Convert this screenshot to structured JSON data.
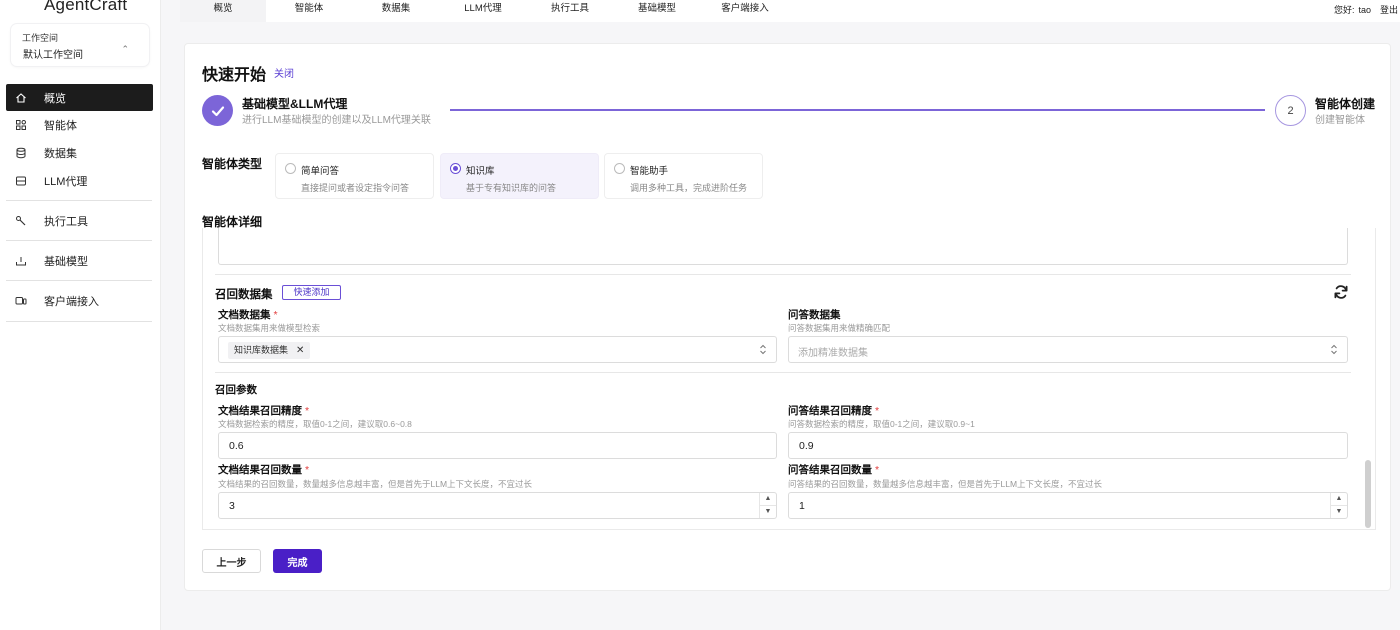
{
  "app": {
    "name": "AgentCraft"
  },
  "workspace": {
    "label": "工作空间",
    "value": "默认工作空间"
  },
  "sidebar": {
    "items": [
      {
        "label": "概览",
        "icon": "home-icon"
      },
      {
        "label": "智能体",
        "icon": "apps-icon"
      },
      {
        "label": "数据集",
        "icon": "database-icon"
      },
      {
        "label": "LLM代理",
        "icon": "server-icon"
      },
      {
        "label": "执行工具",
        "icon": "tool-icon"
      },
      {
        "label": "基础模型",
        "icon": "model-icon"
      },
      {
        "label": "客户端接入",
        "icon": "client-icon"
      }
    ],
    "active_index": 0
  },
  "tabs": [
    "概览",
    "智能体",
    "数据集",
    "LLM代理",
    "执行工具",
    "基础模型",
    "客户端接入"
  ],
  "header": {
    "greeting": "您好:",
    "user": "tao",
    "logout": "登出"
  },
  "quickstart": {
    "title": "快速开始",
    "close": "关闭"
  },
  "steps": [
    {
      "title": "基础模型&LLM代理",
      "desc": "进行LLM基础模型的创建以及LLM代理关联",
      "status": "done"
    },
    {
      "number": "2",
      "title": "智能体创建",
      "desc": "创建智能体",
      "status": "current"
    }
  ],
  "agent_type": {
    "label": "智能体类型",
    "options": [
      {
        "title": "简单问答",
        "desc": "直接提问或者设定指令问答"
      },
      {
        "title": "知识库",
        "desc": "基于专有知识库的问答"
      },
      {
        "title": "智能助手",
        "desc": "调用多种工具，完成进阶任务"
      }
    ],
    "selected": 1
  },
  "detail": {
    "label": "智能体详细"
  },
  "recall_dataset": {
    "title": "召回数据集",
    "quick_add": "快速添加",
    "doc_dataset": {
      "label": "文档数据集",
      "required": "*",
      "hint": "文档数据集用来做模型检索",
      "tag": "知识库数据集",
      "tag_remove": "✕"
    },
    "qa_dataset": {
      "label": "问答数据集",
      "hint": "问答数据集用来做精确匹配",
      "placeholder": "添加精准数据集"
    }
  },
  "recall_params": {
    "title": "召回参数",
    "doc_precision": {
      "label": "文档结果召回精度",
      "required": "*",
      "hint": "文档数据检索的精度，取值0-1之间，建议取0.6~0.8",
      "value": "0.6"
    },
    "qa_precision": {
      "label": "问答结果召回精度",
      "required": "*",
      "hint": "问答数据检索的精度，取值0-1之间，建议取0.9~1",
      "value": "0.9"
    },
    "doc_count": {
      "label": "文档结果召回数量",
      "required": "*",
      "hint": "文档结果的召回数量，数量越多信息越丰富，但是首先于LLM上下文长度，不宜过长",
      "value": "3"
    },
    "qa_count": {
      "label": "问答结果召回数量",
      "required": "*",
      "hint": "问答结果的召回数量，数量越多信息越丰富，但是首先于LLM上下文长度，不宜过长",
      "value": "1"
    }
  },
  "buttons": {
    "prev": "上一步",
    "done": "完成"
  },
  "colors": {
    "accent": "#7c65d8",
    "primary_button": "#4a1fc7",
    "required": "#e23b3b",
    "nav_active": "#1c1c1c"
  }
}
